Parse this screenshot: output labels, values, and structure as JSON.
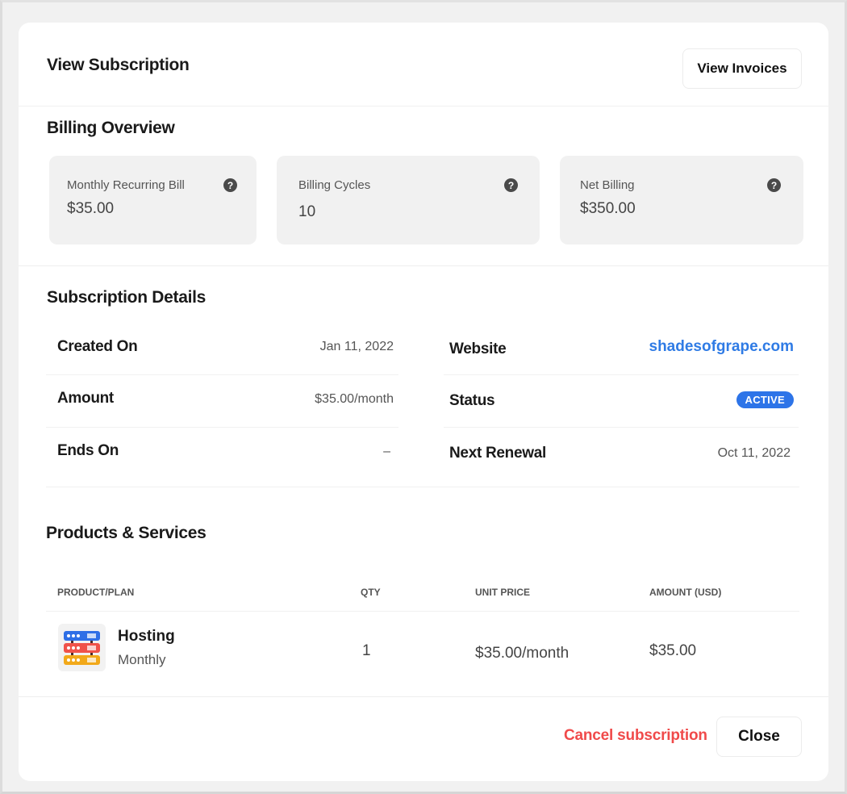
{
  "header": {
    "title": "View Subscription",
    "view_invoices_label": "View Invoices"
  },
  "billing_overview": {
    "title": "Billing Overview",
    "cards": [
      {
        "label": "Monthly Recurring Bill",
        "value": "$35.00",
        "icon": "help-icon"
      },
      {
        "label": "Billing Cycles",
        "value": "10",
        "icon": "help-icon"
      },
      {
        "label": "Net Billing",
        "value": "$350.00",
        "icon": "help-icon"
      }
    ],
    "help_glyph": "?"
  },
  "subscription_details": {
    "title": "Subscription Details",
    "left": [
      {
        "label": "Created On",
        "value": "Jan 11, 2022"
      },
      {
        "label": "Amount",
        "value": "$35.00/month"
      },
      {
        "label": "Ends On",
        "value": "–"
      }
    ],
    "right": [
      {
        "label": "Website",
        "value": "shadesofgrape.com"
      },
      {
        "label": "Status",
        "value": "ACTIVE"
      },
      {
        "label": "Next Renewal",
        "value": "Oct 11, 2022"
      }
    ]
  },
  "products": {
    "title": "Products & Services",
    "columns": [
      "PRODUCT/PLAN",
      "QTY",
      "UNIT PRICE",
      "AMOUNT (USD)"
    ],
    "rows": [
      {
        "icon": "server-rack-icon",
        "name": "Hosting",
        "plan": "Monthly",
        "qty": "1",
        "unit_price": "$35.00/month",
        "amount": "$35.00"
      }
    ]
  },
  "footer": {
    "cancel_label": "Cancel subscription",
    "close_label": "Close"
  },
  "colors": {
    "accent_blue": "#2d74e8",
    "link_blue": "#2f7be5",
    "danger_red": "#f04a4a",
    "card_bg": "#f1f1f1"
  }
}
